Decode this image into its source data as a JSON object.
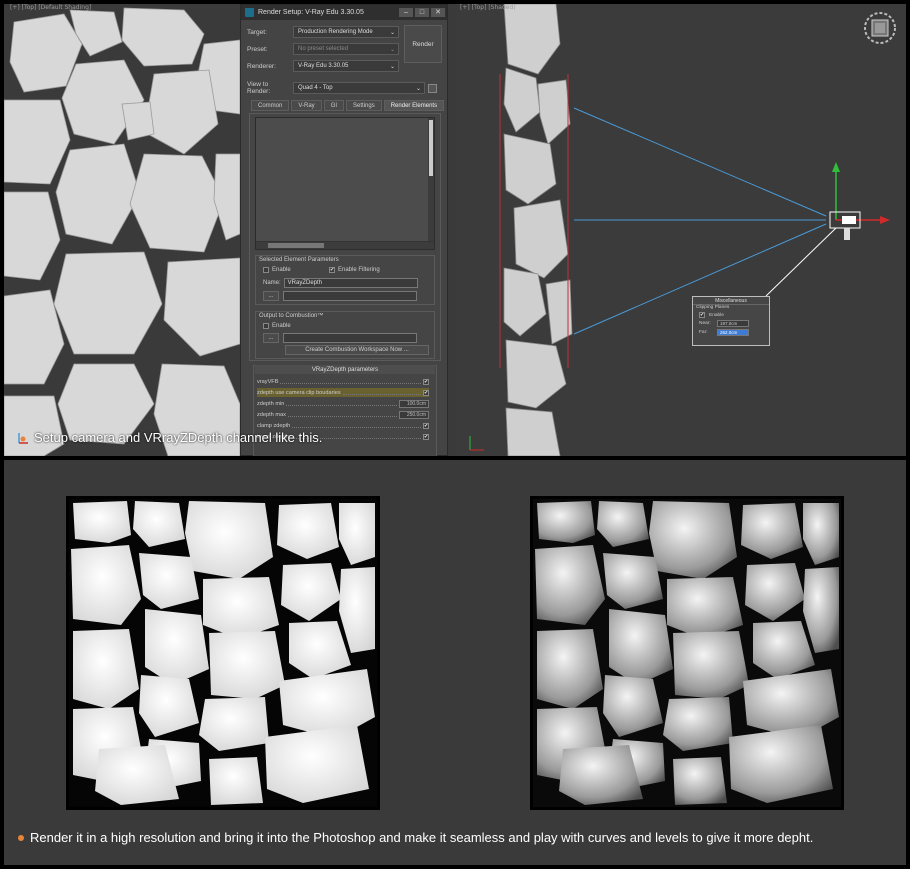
{
  "viewports": {
    "left_label": "[+] [Top] [Default Shading]",
    "right_label": "[+] [Top] [Shaded]"
  },
  "dialog": {
    "title": "Render Setup: V-Ray Edu 3.30.05",
    "minimize": "–",
    "maximize": "□",
    "close": "✕",
    "target_label": "Target:",
    "target_value": "Production Rendering Mode",
    "preset_label": "Preset:",
    "preset_value": "No preset selected",
    "renderer_label": "Renderer:",
    "renderer_value": "V-Ray Edu 3.30.05",
    "view_label": "View to Render:",
    "view_value": "Quad 4 - Top",
    "render_button": "Render",
    "tabs": [
      "Common",
      "V-Ray",
      "GI",
      "Settings",
      "Render Elements"
    ],
    "selected_params_title": "Selected Element Parameters",
    "enable_label": "Enable",
    "enable_filtering_label": "Enable Filtering",
    "name_label": "Name:",
    "name_value": "VRayZDepth",
    "browse_button": "...",
    "combustion_title": "Output to Combustion™",
    "combustion_enable": "Enable",
    "combustion_button": "Create Combustion Workspace Now ...",
    "zdepth_title": "VRayZDepth parameters",
    "params": [
      {
        "label": "vrayVFB",
        "checked": true
      },
      {
        "label": "zdepth use camera clip boudaries",
        "checked": true
      },
      {
        "label": "zdepth min",
        "value": "100.0cm"
      },
      {
        "label": "zdepth max",
        "value": "250.0cm"
      },
      {
        "label": "clamp zdepth",
        "checked": true
      },
      {
        "label": "invert zdepth",
        "checked": true
      }
    ]
  },
  "clipping": {
    "title": "Miscellaneous",
    "section": "Clipping Planes",
    "enable_label": "Enable",
    "near_label": "Near:",
    "near_value": "197.0cm",
    "far_label": "Far:",
    "far_value": "262.0cm"
  },
  "captions": {
    "top": "Setup camera and VRrayZDepth channel like this.",
    "bottom": "Render it in a high resolution and bring it into the Photoshop and make it seamless and play with curves and levels to give it more depht."
  },
  "colors": {
    "accent_orange": "#e8843a",
    "highlight_row": "#6a6130",
    "selection_blue": "#3d7bd6"
  }
}
